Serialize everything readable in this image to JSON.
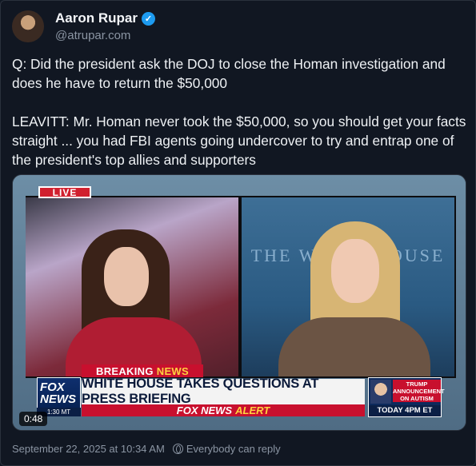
{
  "author": {
    "name": "Aaron Rupar",
    "handle": "@atrupar.com",
    "verified_glyph": "✓"
  },
  "tweet": {
    "text": "Q: Did the president ask the DOJ to close the Homan investigation and does he have to return the $50,000\n\nLEAVITT: Mr. Homan never took the $50,000, so you should get your facts straight ... you had FBI agents going undercover to try and entrap one of the president's top allies and supporters"
  },
  "video": {
    "duration": "0:48",
    "live_label": "LIVE",
    "background_text": "THE WHITE HOUSE",
    "breaking_label": "BREAKING",
    "breaking_news_word": "NEWS",
    "logo_text": "FOX NEWS",
    "logo_time": "1:30 MT",
    "headline": "WHITE HOUSE TAKES QUESTIONS AT PRESS BRIEFING",
    "alert_brand": "FOX NEWS",
    "alert_word": "ALERT",
    "promo_title": "TRUMP ANNOUNCEMENT ON AUTISM",
    "promo_time": "TODAY 4PM ET"
  },
  "footer": {
    "timestamp": "September 22, 2025 at 10:34 AM",
    "reply_setting": "Everybody can reply"
  },
  "icons": {
    "verified": "verified-badge-icon",
    "reply_setting": "globe-icon"
  },
  "colors": {
    "background": "#111722",
    "text": "#eef1f4",
    "muted": "#8b95a3",
    "verified": "#1d9bf0",
    "fox_red": "#c8102e"
  }
}
